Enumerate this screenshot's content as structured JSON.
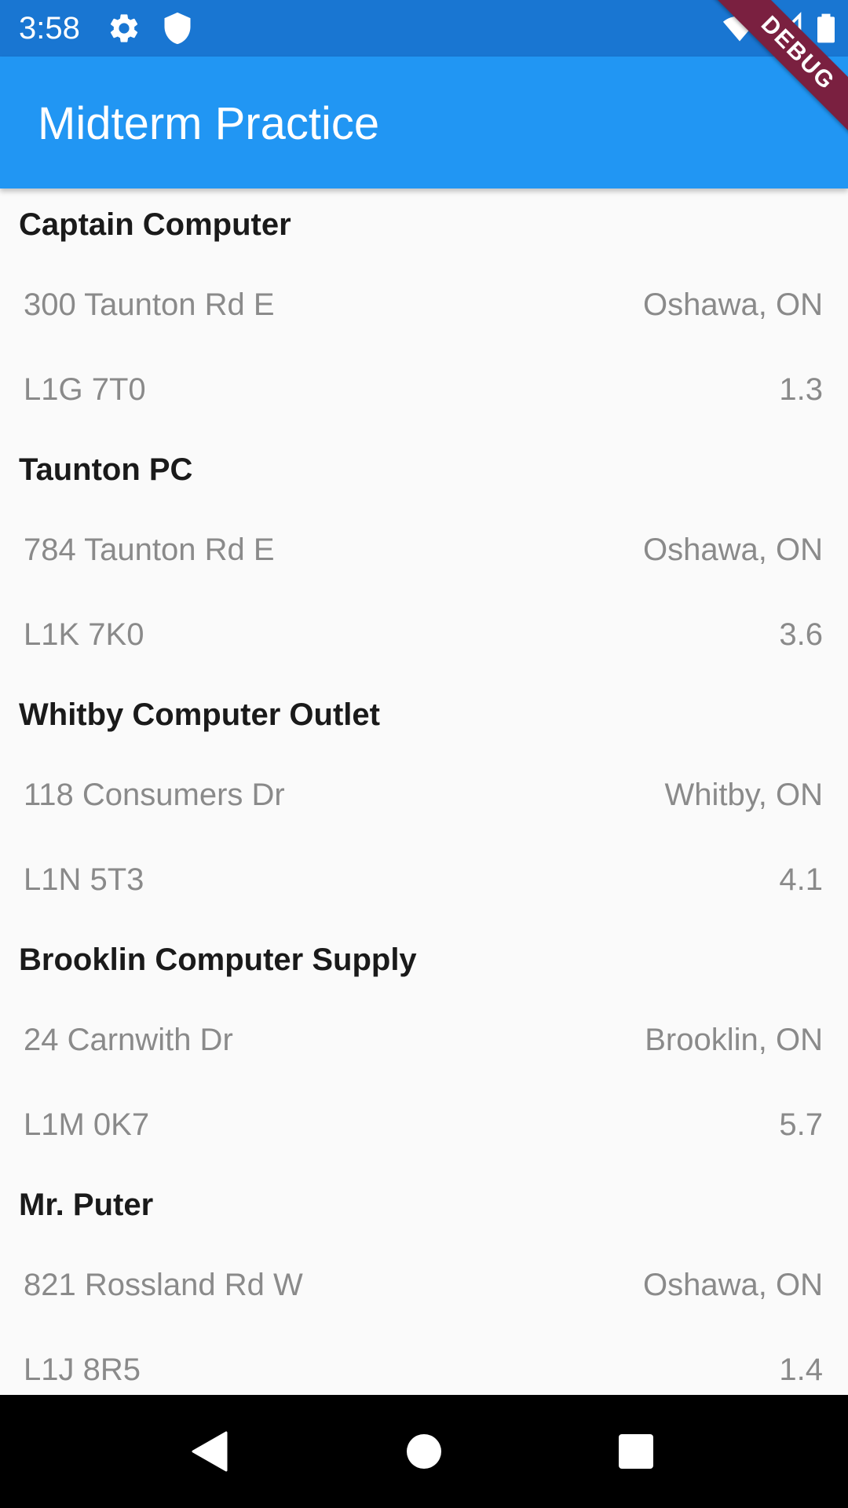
{
  "status_bar": {
    "time": "3:58",
    "icons": [
      "gear-icon",
      "shield-icon",
      "wifi-icon",
      "signal-icon",
      "battery-icon"
    ]
  },
  "app_bar": {
    "title": "Midterm Practice",
    "color": "#2196f3"
  },
  "debug_banner": "DEBUG",
  "stores": [
    {
      "name": "Captain Computer",
      "address": "300 Taunton Rd E",
      "city": "Oshawa, ON",
      "postal": "L1G 7T0",
      "distance": "1.3"
    },
    {
      "name": "Taunton PC",
      "address": "784 Taunton Rd E",
      "city": "Oshawa, ON",
      "postal": "L1K 7K0",
      "distance": "3.6"
    },
    {
      "name": "Whitby Computer Outlet",
      "address": "118 Consumers Dr",
      "city": "Whitby, ON",
      "postal": "L1N 5T3",
      "distance": "4.1"
    },
    {
      "name": "Brooklin Computer Supply",
      "address": "24 Carnwith Dr",
      "city": "Brooklin, ON",
      "postal": "L1M 0K7",
      "distance": "5.7"
    },
    {
      "name": "Mr. Puter",
      "address": "821 Rossland Rd W",
      "city": "Oshawa, ON",
      "postal": "L1J 8R5",
      "distance": "1.4"
    }
  ],
  "nav_bar": {
    "icons": [
      "back-icon",
      "home-icon",
      "recents-icon"
    ]
  }
}
